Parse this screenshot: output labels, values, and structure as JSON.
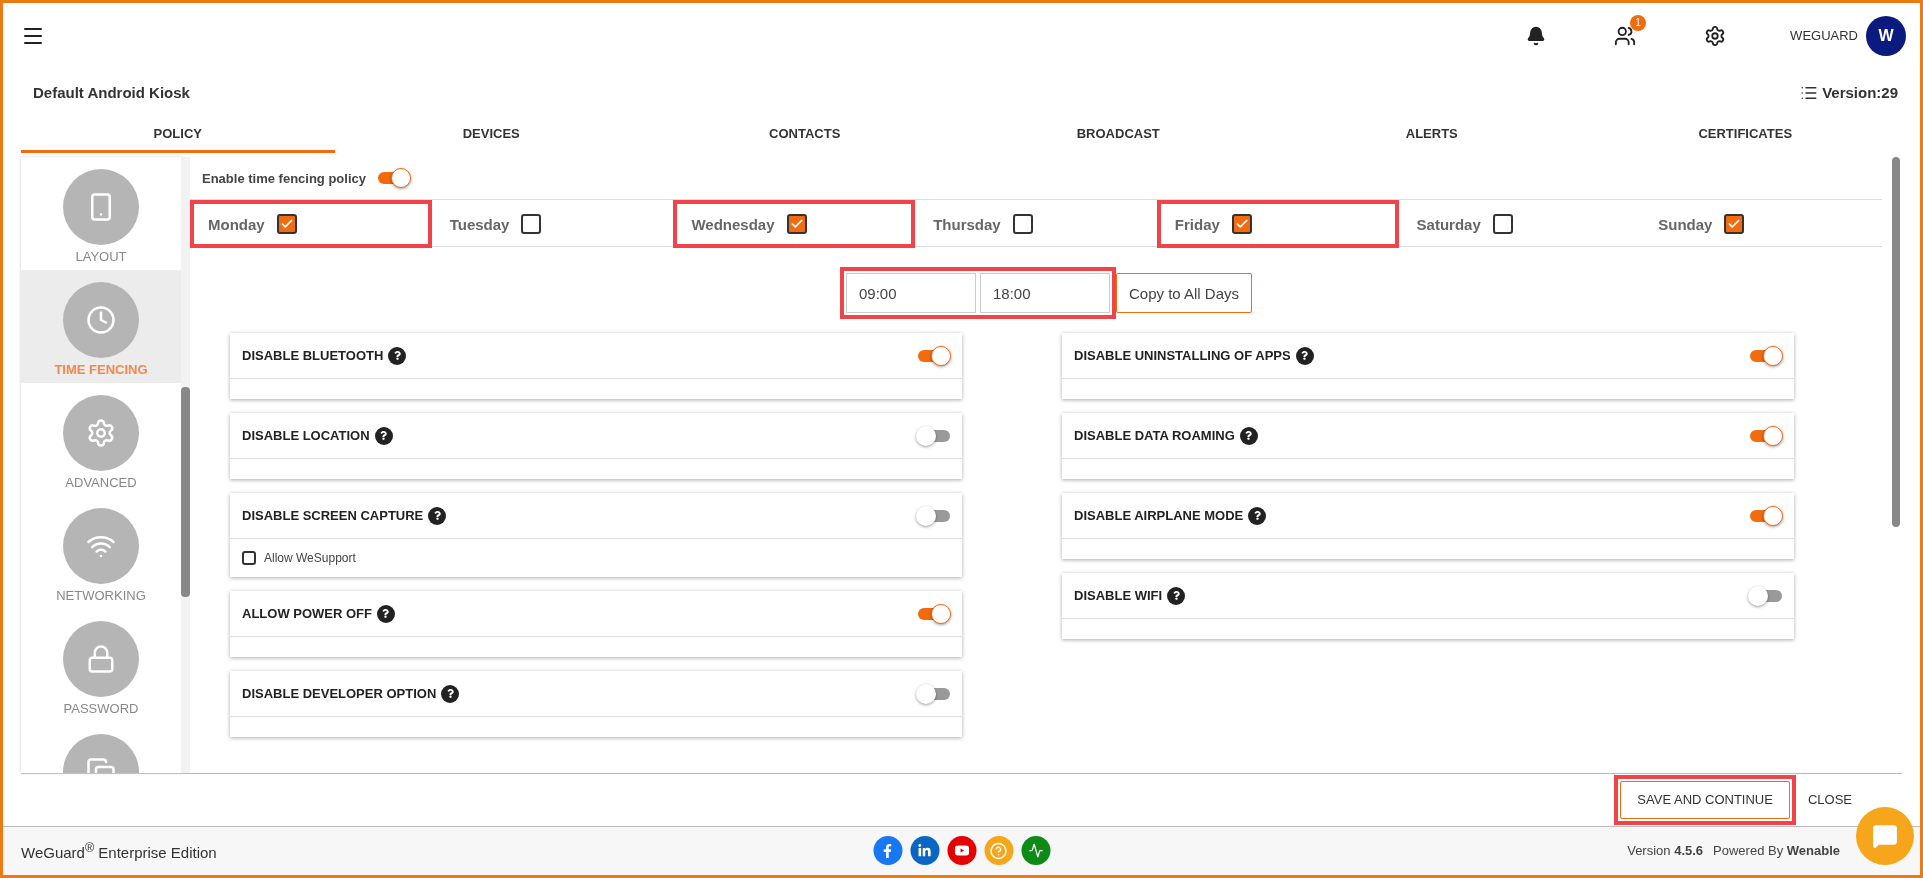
{
  "header": {
    "user": "WEGUARD",
    "avatar": "W",
    "notification_badge": "1"
  },
  "page": {
    "title": "Default Android Kiosk",
    "version": "Version:29"
  },
  "tabs": [
    {
      "label": "POLICY",
      "selected": true
    },
    {
      "label": "DEVICES",
      "selected": false
    },
    {
      "label": "CONTACTS",
      "selected": false
    },
    {
      "label": "BROADCAST",
      "selected": false
    },
    {
      "label": "ALERTS",
      "selected": false
    },
    {
      "label": "CERTIFICATES",
      "selected": false
    }
  ],
  "sidebar": {
    "items": [
      {
        "label": "LAYOUT",
        "selected": false
      },
      {
        "label": "TIME FENCING",
        "selected": true
      },
      {
        "label": "ADVANCED",
        "selected": false
      },
      {
        "label": "NETWORKING",
        "selected": false
      },
      {
        "label": "PASSWORD",
        "selected": false
      },
      {
        "selected": false
      }
    ]
  },
  "enable_policy": {
    "label": "Enable time fencing policy",
    "on": true
  },
  "days": [
    {
      "label": "Monday",
      "checked": true,
      "highlighted": true
    },
    {
      "label": "Tuesday",
      "checked": false,
      "highlighted": false
    },
    {
      "label": "Wednesday",
      "checked": true,
      "highlighted": true
    },
    {
      "label": "Thursday",
      "checked": false,
      "highlighted": false
    },
    {
      "label": "Friday",
      "checked": true,
      "highlighted": true
    },
    {
      "label": "Saturday",
      "checked": false,
      "highlighted": false
    },
    {
      "label": "Sunday",
      "checked": true,
      "highlighted": false
    }
  ],
  "time_range": {
    "start": "09:00",
    "end": "18:00",
    "highlighted": true,
    "copy_button": "Copy to All Days"
  },
  "settings_left": [
    {
      "label": "DISABLE BLUETOOTH",
      "on": true
    },
    {
      "label": "DISABLE LOCATION",
      "on": false
    },
    {
      "label": "DISABLE SCREEN CAPTURE",
      "on": false,
      "option": {
        "label": "Allow WeSupport",
        "checked": false
      }
    },
    {
      "label": "ALLOW POWER OFF",
      "on": true
    },
    {
      "label": "DISABLE DEVELOPER OPTION",
      "on": false
    }
  ],
  "settings_right": [
    {
      "label": "DISABLE UNINSTALLING OF APPS",
      "on": true
    },
    {
      "label": "DISABLE DATA ROAMING",
      "on": true
    },
    {
      "label": "DISABLE AIRPLANE MODE",
      "on": true
    },
    {
      "label": "DISABLE WIFI",
      "on": false
    }
  ],
  "actions": {
    "save": "SAVE AND CONTINUE",
    "save_highlighted": true,
    "close": "CLOSE"
  },
  "footer": {
    "product": "WeGuard$^{®}$ Enterprise Edition",
    "version": "Version **4.5.6**",
    "powered": "Powered By **Wenable**"
  }
}
